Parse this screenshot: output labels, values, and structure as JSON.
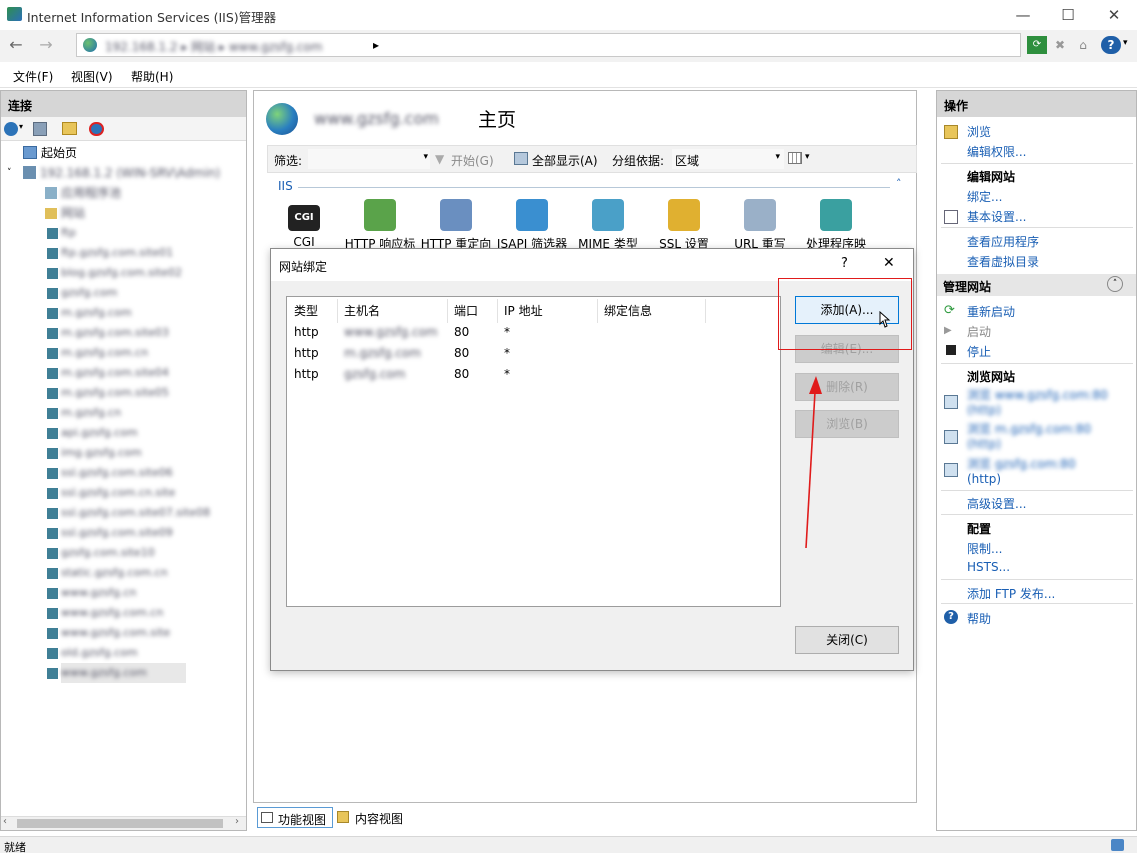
{
  "window": {
    "title": "Internet Information Services (IIS)管理器",
    "minimize": "—",
    "maximize": "☐",
    "close": "✕"
  },
  "address": {
    "back": "←",
    "forward": "→",
    "path_blurred": "192.168.1.2 ▸ 网站 ▸ www.gzsfg.com",
    "arrow": "▸"
  },
  "menu": {
    "file": "文件(F)",
    "view": "视图(V)",
    "help": "帮助(H)"
  },
  "left": {
    "title": "连接",
    "start_page": "起始页",
    "server_blurred": "192.168.1.2 (WIN-SRV\\Admin)",
    "app_pools_blurred": "应用程序池",
    "sites_blurred": "网站",
    "sites": [
      "ftp",
      "ftp.gzsfg.com.site01",
      "blog.gzsfg.com.site02",
      "gzsfg.com",
      "m.gzsfg.com",
      "m.gzsfg.com.site03",
      "m.gzsfg.com.cn",
      "m.gzsfg.com.site04",
      "m.gzsfg.com.site05",
      "m.gzsfg.cn",
      "api.gzsfg.com",
      "img.gzsfg.com",
      "ssl.gzsfg.com.site06",
      "ssl.gzsfg.com.cn.site",
      "ssl.gzsfg.com.site07.site08",
      "ssl.gzsfg.com.site09",
      "gzsfg.com.site10",
      "static.gzsfg.com.cn",
      "www.gzsfg.cn",
      "www.gzsfg.com.cn",
      "www.gzsfg.com.site",
      "old.gzsfg.com",
      "www.gzsfg.com"
    ]
  },
  "center": {
    "site_name_blurred": "www.gzsfg.com",
    "title_suffix": "主页",
    "filter_label": "筛选:",
    "start": "开始(G)",
    "show_all": "全部显示(A)",
    "group_label": "分组依据:",
    "group_value": "区域",
    "group_name": "IIS",
    "features": [
      "CGI",
      "HTTP 响应标",
      "HTTP 重定向",
      "ISAPI 筛选器",
      "MIME 类型",
      "SSL 设置",
      "URL 重写",
      "处理程序映"
    ],
    "cgi_badge": "CGI",
    "views": {
      "features": "功能视图",
      "content": "内容视图"
    }
  },
  "dialog": {
    "title": "网站绑定",
    "help": "?",
    "close": "✕",
    "columns": [
      "类型",
      "主机名",
      "端口",
      "IP 地址",
      "绑定信息"
    ],
    "rows": [
      {
        "type": "http",
        "host": "www.gzsfg.com",
        "port": "80",
        "ip": "*"
      },
      {
        "type": "http",
        "host": "m.gzsfg.com",
        "port": "80",
        "ip": "*"
      },
      {
        "type": "http",
        "host": "gzsfg.com",
        "port": "80",
        "ip": "*"
      }
    ],
    "buttons": {
      "add": "添加(A)...",
      "edit": "编辑(E)...",
      "remove": "删除(R)",
      "browse": "浏览(B)",
      "close": "关闭(C)"
    }
  },
  "right": {
    "title": "操作",
    "browse": "浏览",
    "edit_perms": "编辑权限...",
    "edit_site": "编辑网站",
    "bindings": "绑定...",
    "basic_settings": "基本设置...",
    "view_apps": "查看应用程序",
    "view_vdirs": "查看虚拟目录",
    "manage_site": "管理网站",
    "restart": "重新启动",
    "start": "启动",
    "stop": "停止",
    "browse_site": "浏览网站",
    "b1_blurred": "浏览 www.gzsfg.com:80 (http)",
    "b2_blurred": "浏览 m.gzsfg.com:80 (http)",
    "b3_blurred": "浏览 gzsfg.com:80",
    "b3_tail": "(http)",
    "advanced": "高级设置...",
    "config": "配置",
    "limits": "限制...",
    "hsts": "HSTS...",
    "add_ftp": "添加 FTP 发布...",
    "help": "帮助"
  },
  "status": {
    "text": "就绪"
  },
  "colors": {
    "link": "#1a5fb4",
    "highlight": "#e01b1b",
    "panel_header": "#d6d6d6"
  }
}
